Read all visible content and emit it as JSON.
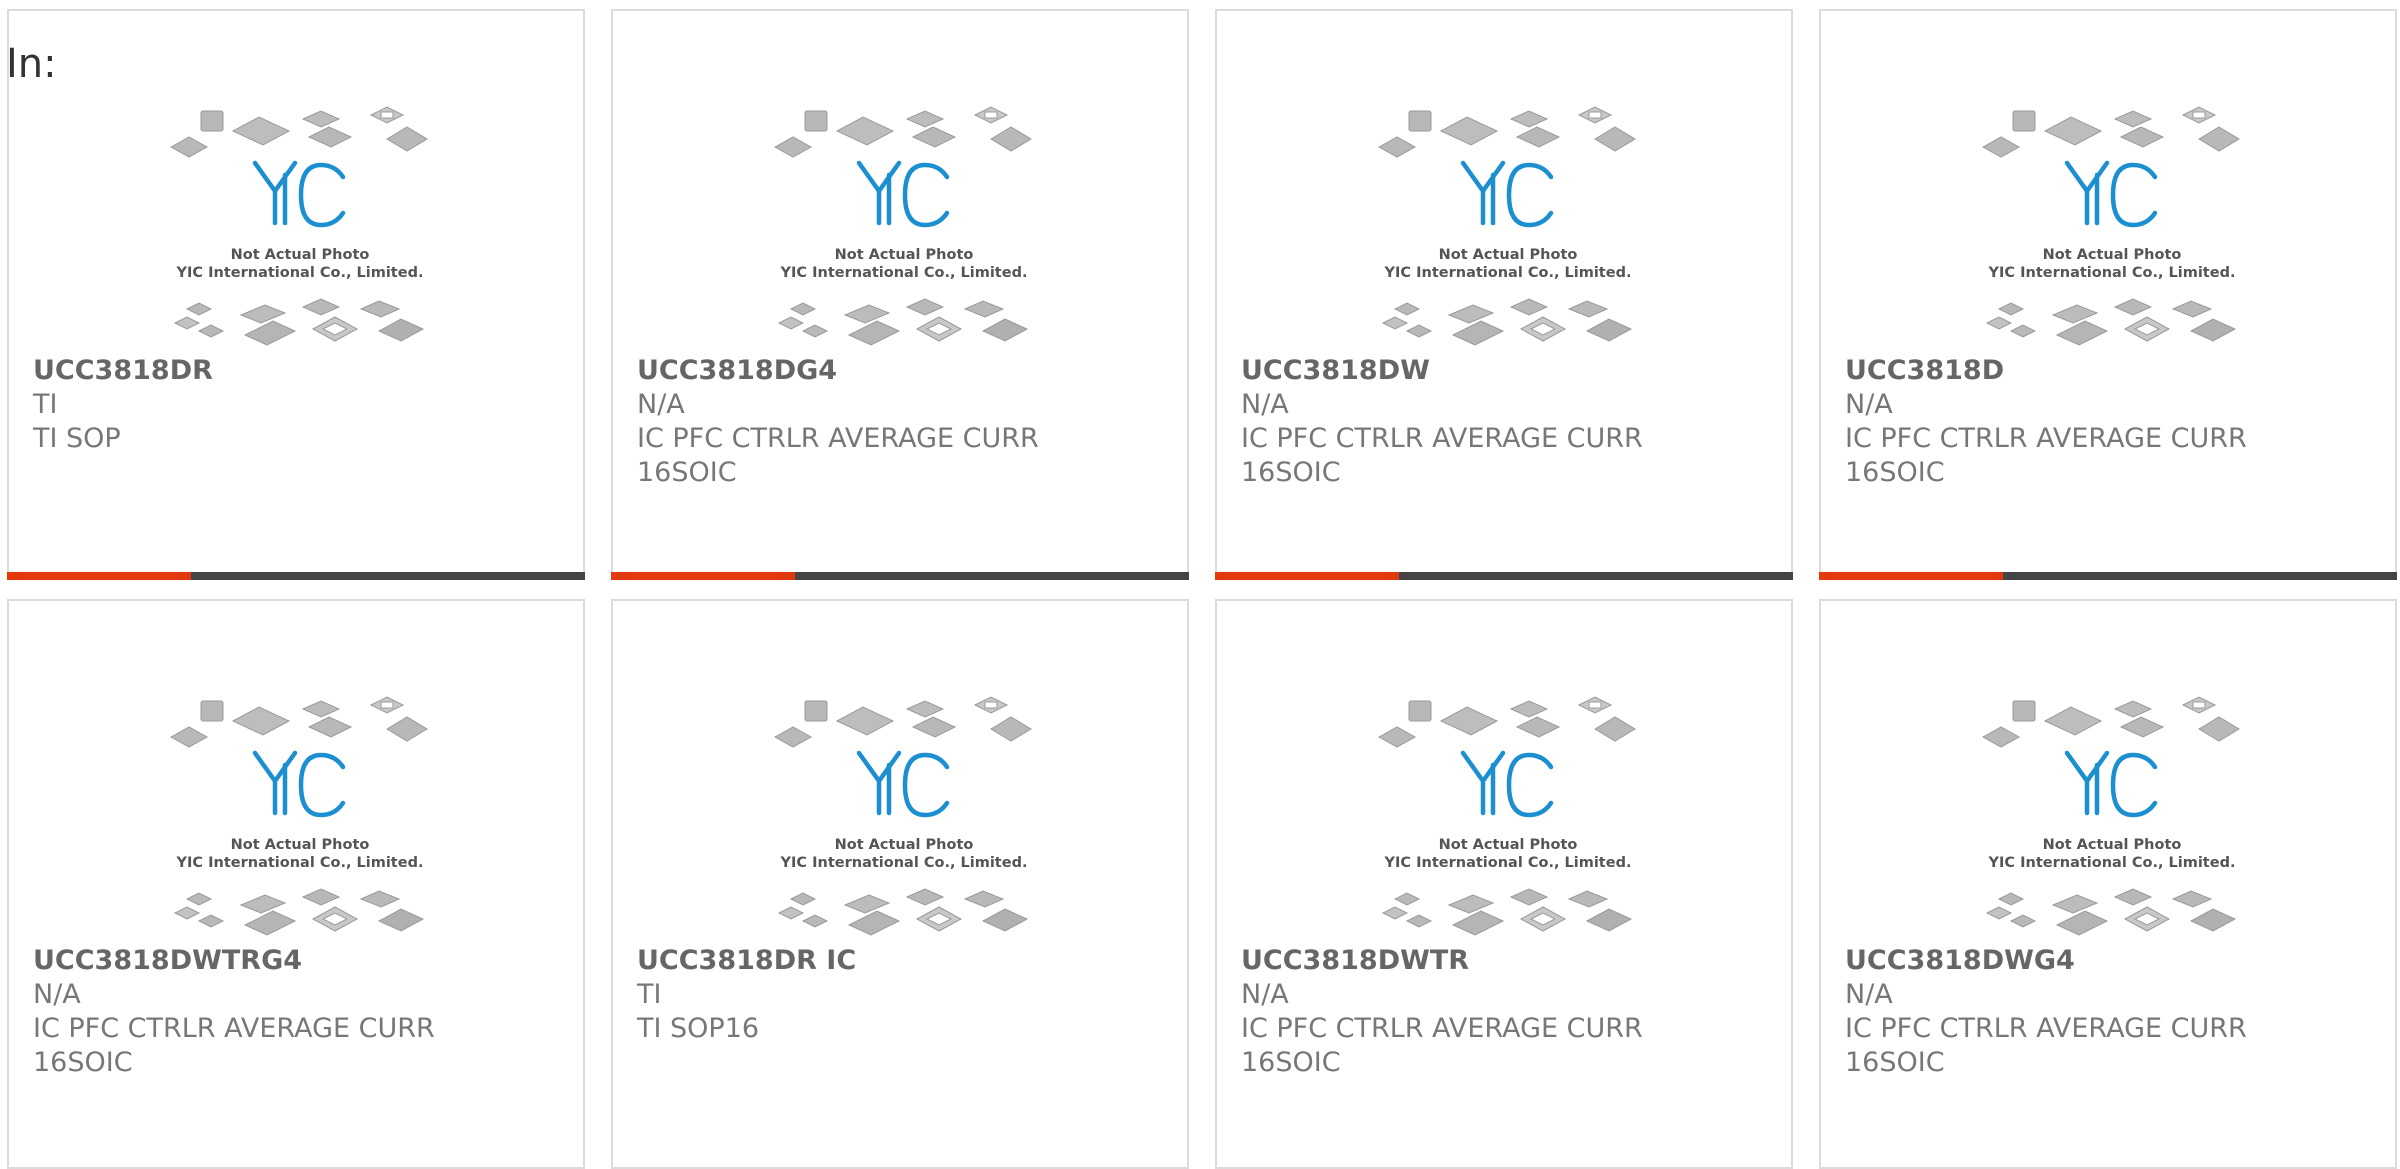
{
  "header": {
    "in_label": "In:"
  },
  "colors": {
    "accent_bar": "#e2390f",
    "dark_bar": "#444444",
    "logo_blue": "#1b8fd0",
    "border": "#dcdcdc"
  },
  "placeholder_image": {
    "line1": "Not Actual Photo",
    "line2": "YIC International Co., Limited.",
    "logo_text": "YIC"
  },
  "products": [
    {
      "part": "UCC3818DR",
      "brand": "TI",
      "description": "TI SOP"
    },
    {
      "part": "UCC3818DG4",
      "brand": "N/A",
      "description": "IC PFC CTRLR AVERAGE CURR 16SOIC"
    },
    {
      "part": "UCC3818DW",
      "brand": "N/A",
      "description": "IC PFC CTRLR AVERAGE CURR 16SOIC"
    },
    {
      "part": "UCC3818D",
      "brand": "N/A",
      "description": "IC PFC CTRLR AVERAGE CURR 16SOIC"
    },
    {
      "part": "UCC3818DWTRG4",
      "brand": "N/A",
      "description": "IC PFC CTRLR AVERAGE CURR 16SOIC"
    },
    {
      "part": "UCC3818DR IC",
      "brand": "TI",
      "description": "TI SOP16"
    },
    {
      "part": "UCC3818DWTR",
      "brand": "N/A",
      "description": "IC PFC CTRLR AVERAGE CURR 16SOIC"
    },
    {
      "part": "UCC3818DWG4",
      "brand": "N/A",
      "description": "IC PFC CTRLR AVERAGE CURR 16SOIC"
    }
  ]
}
